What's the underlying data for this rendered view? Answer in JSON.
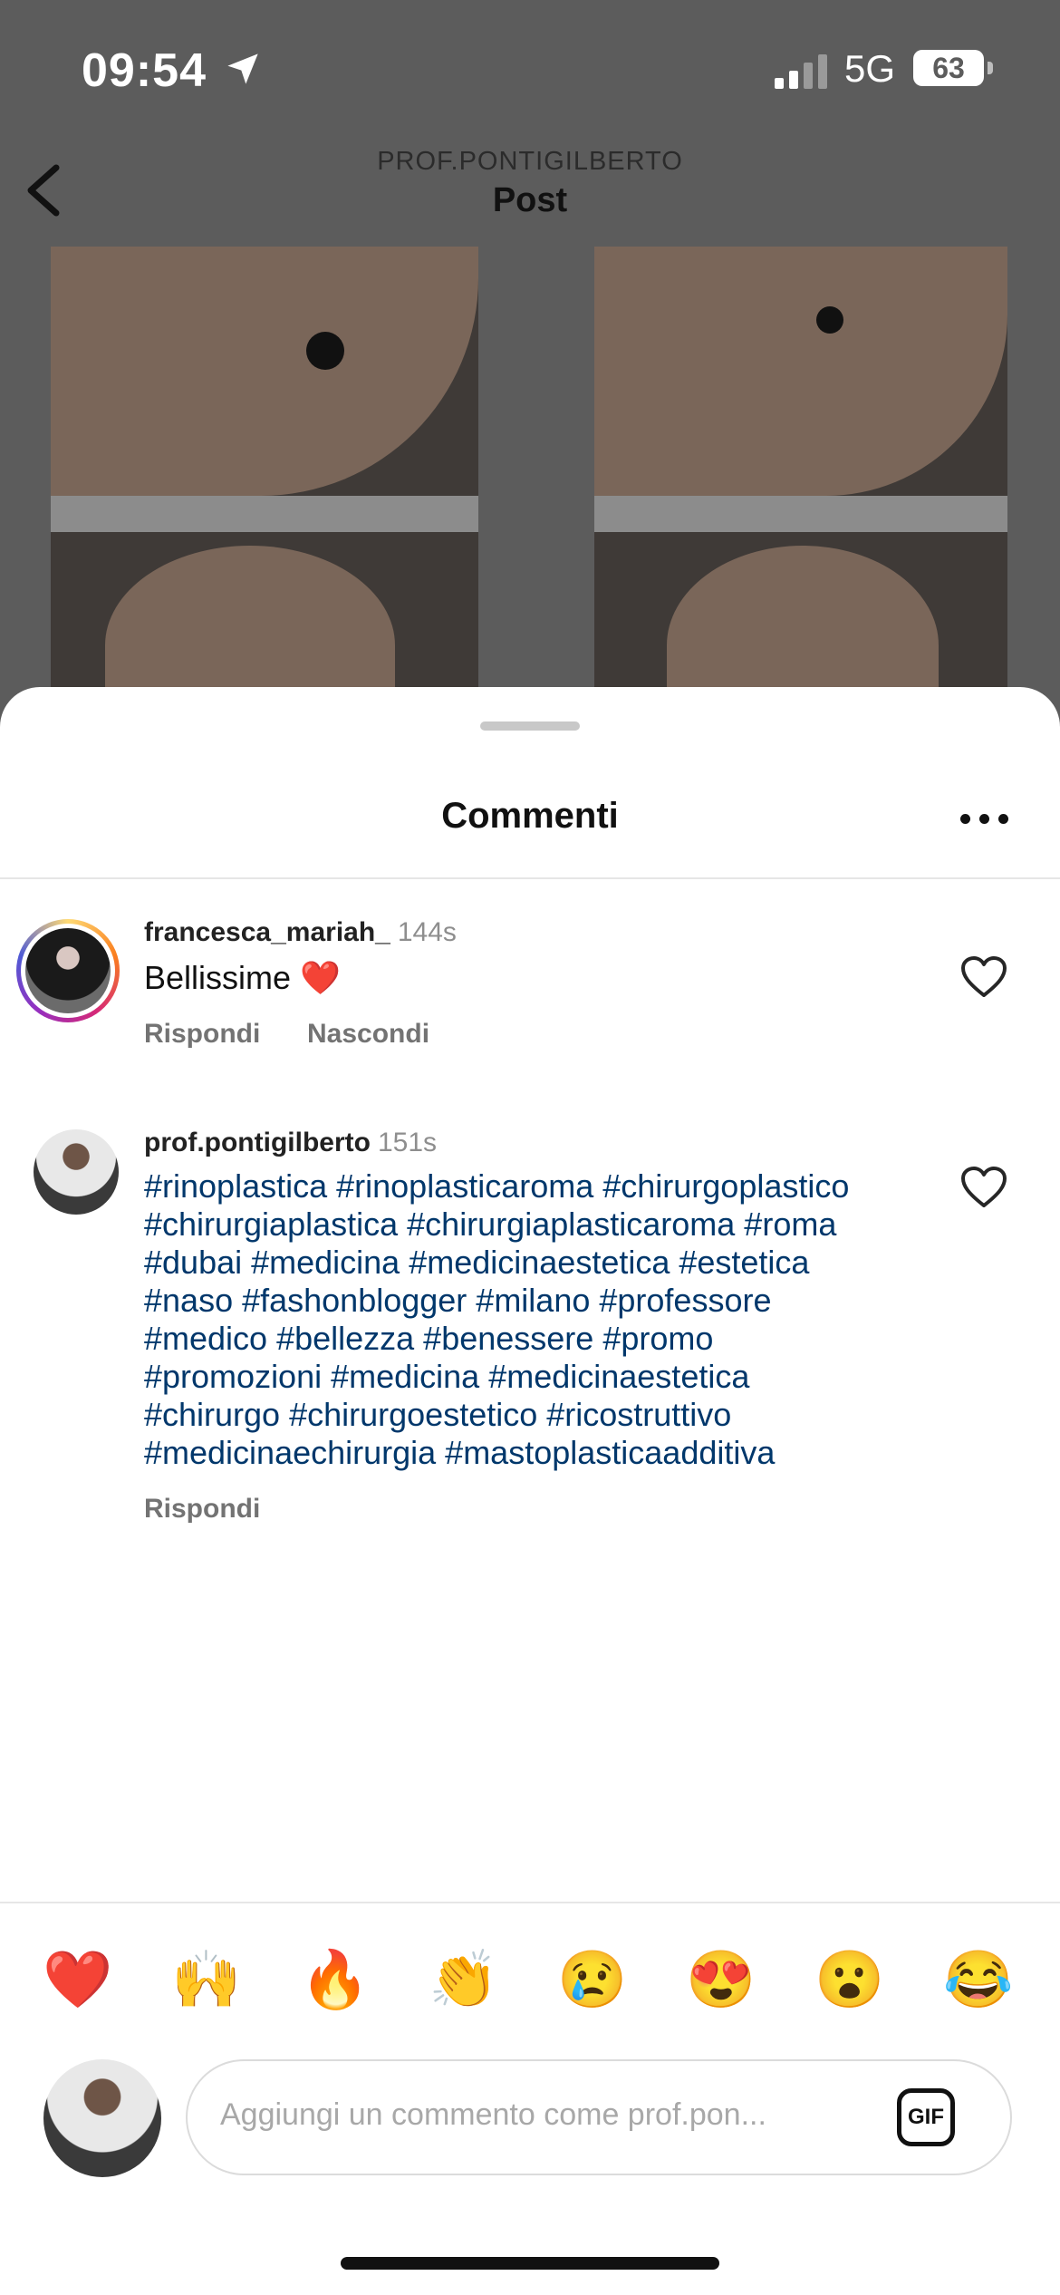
{
  "status_bar": {
    "time": "09:54",
    "network": "5G",
    "battery": "63"
  },
  "nav": {
    "account": "PROF.PONTIGILBERTO",
    "title": "Post"
  },
  "comments_sheet": {
    "title": "Commenti",
    "comments": [
      {
        "username": "francesca_mariah_",
        "age": "144s",
        "text": "Bellissime ❤️",
        "actions": [
          "Rispondi",
          "Nascondi"
        ]
      },
      {
        "username": "prof.pontigilberto",
        "age": "151s",
        "hashtag_lines": [
          "#rinoplastica #rinoplasticaroma #chirurgoplastico",
          "#chirurgiaplastica #chirurgiaplasticaroma #roma",
          "#dubai #medicina #medicinaestetica #estetica",
          "#naso #fashonblogger #milano #professore",
          "#medico #bellezza #benessere #promo",
          "#promozioni #medicina #medicinaestetica",
          "#chirurgo #chirurgoestetico #ricostruttivo",
          "#medicinaechirurgia #mastoplasticaadditiva"
        ],
        "actions": [
          "Rispondi"
        ]
      }
    ]
  },
  "emoji_bar": [
    "❤️",
    "🙌",
    "🔥",
    "👏",
    "😢",
    "😍",
    "😮",
    "😂"
  ],
  "composer": {
    "placeholder": "Aggiungi un commento come prof.pon...",
    "gif_label": "GIF"
  },
  "colors": {
    "hashtag": "#00376b",
    "sheet_bg": "#ffffff",
    "overlay": "#5c5c5c",
    "action_gray": "#737373"
  }
}
